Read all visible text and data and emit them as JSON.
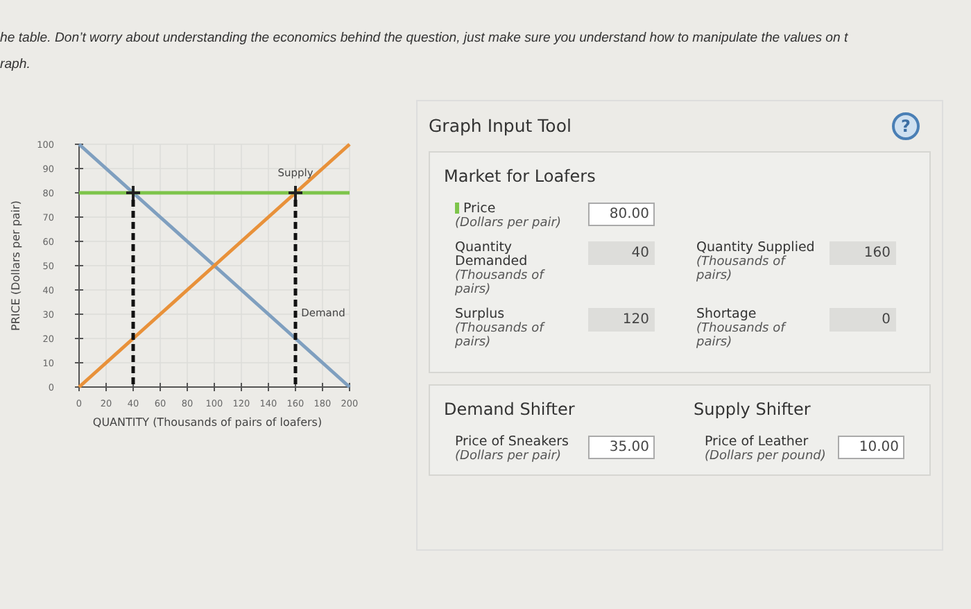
{
  "instructions": {
    "line_1": "he table. Don’t worry about understanding the economics behind the question, just make sure you understand how to manipulate the values on t",
    "line_2": "raph."
  },
  "graph": {
    "chart_data": {
      "type": "line",
      "xlabel": "QUANTITY (Thousands of pairs of loafers)",
      "ylabel": "PRICE (Dollars per pair)",
      "x": [
        0,
        20,
        40,
        60,
        80,
        100,
        120,
        140,
        160,
        180,
        200
      ],
      "xlim": [
        0,
        200
      ],
      "ylim": [
        0,
        100
      ],
      "xticks": [
        0,
        20,
        40,
        60,
        80,
        100,
        120,
        140,
        160,
        180,
        200
      ],
      "yticks": [
        0,
        10,
        20,
        30,
        40,
        50,
        60,
        70,
        80,
        90,
        100
      ],
      "grid": true,
      "series": [
        {
          "name": "Demand",
          "color": "#7f9fbf",
          "values": [
            100,
            90,
            80,
            70,
            60,
            50,
            40,
            30,
            20,
            10,
            0
          ]
        },
        {
          "name": "Supply",
          "color": "#e8913a",
          "values": [
            0,
            10,
            20,
            30,
            40,
            50,
            60,
            70,
            80,
            90,
            100
          ]
        }
      ],
      "ref_lines": [
        {
          "axis": "y",
          "value": 80,
          "color": "#7dc44a"
        }
      ]
    }
  },
  "tool": {
    "title": "Graph Input Tool",
    "help_button": "?",
    "market": {
      "title": "Market for Loafers",
      "rows": [
        [
          {
            "label": "Price",
            "unit": "(Dollars per pair)",
            "value": "80.00",
            "kind": "input",
            "color": "#7dc44a"
          }
        ],
        [
          {
            "label": "Quantity Demanded",
            "unit": "(Thousands of pairs)",
            "value": "40",
            "kind": "output"
          },
          {
            "label": "Quantity Supplied",
            "unit": "(Thousands of pairs)",
            "value": "160",
            "kind": "output"
          }
        ],
        [
          {
            "label": "Surplus",
            "unit": "(Thousands of pairs)",
            "value": "120",
            "kind": "output"
          },
          {
            "label": "Shortage",
            "unit": "(Thousands of pairs)",
            "value": "0",
            "kind": "output"
          }
        ]
      ]
    },
    "shifters": [
      {
        "title": "Demand Shifter",
        "label": "Price of Sneakers",
        "unit": "(Dollars per pair)",
        "value": "35.00",
        "kind": "input"
      },
      {
        "title": "Supply Shifter",
        "label": "Price of Leather",
        "unit": "(Dollars per pound)",
        "value": "10.00",
        "kind": "input"
      }
    ]
  }
}
